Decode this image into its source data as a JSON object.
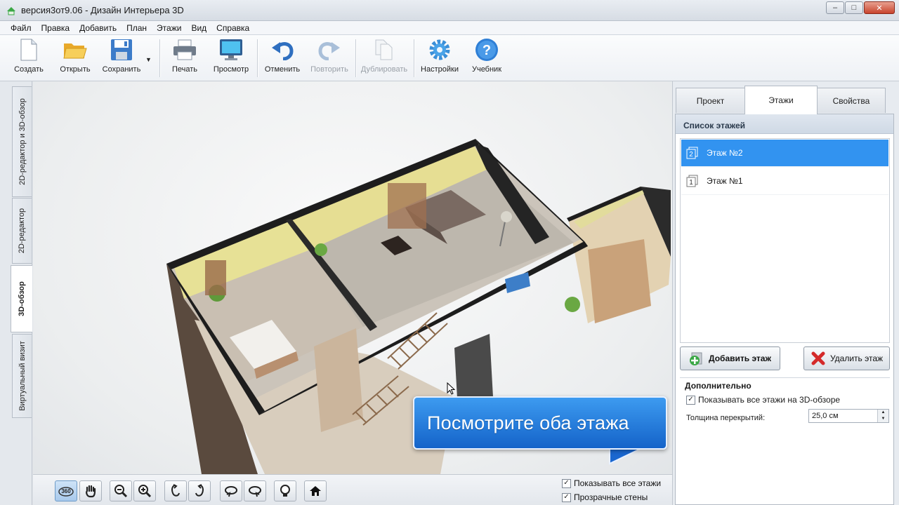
{
  "window": {
    "title": "версия3от9.06 - Дизайн Интерьера 3D"
  },
  "menu": [
    "Файл",
    "Правка",
    "Добавить",
    "План",
    "Этажи",
    "Вид",
    "Справка"
  ],
  "toolbar": {
    "create": "Создать",
    "open": "Открыть",
    "save": "Сохранить",
    "print": "Печать",
    "preview": "Просмотр",
    "undo": "Отменить",
    "redo": "Повторить",
    "duplicate": "Дублировать",
    "settings": "Настройки",
    "tutorial": "Учебник"
  },
  "left_tabs": [
    "2D-редактор и 3D-обзор",
    "2D-редактор",
    "3D-обзор",
    "Виртуальный визит"
  ],
  "callout": {
    "text": "Посмотрите оба этажа"
  },
  "bottom": {
    "show_all_floors": "Показывать все этажи",
    "transparent_walls": "Прозрачные стены",
    "tools": [
      "360-icon",
      "hand-icon",
      "zoom-out-icon",
      "zoom-in-icon",
      "rotate-left-icon",
      "rotate-right-icon",
      "tilt-down-icon",
      "tilt-up-icon",
      "light-icon",
      "home-icon"
    ]
  },
  "right_panel": {
    "tabs": [
      "Проект",
      "Этажи",
      "Свойства"
    ],
    "active_tab": "Этажи",
    "list_title": "Список этажей",
    "floors": [
      {
        "num": "2",
        "label": "Этаж №2",
        "selected": true
      },
      {
        "num": "1",
        "label": "Этаж №1",
        "selected": false
      }
    ],
    "add_floor": "Добавить этаж",
    "delete_floor": "Удалить этаж",
    "extra_title": "Дополнительно",
    "show_all_3d": "Показывать все этажи на 3D-обзоре",
    "slab_label": "Толщина перекрытий:",
    "slab_value": "25,0 см"
  },
  "colors": {
    "selection": "#3293f0",
    "callout": "#1f76dc",
    "disabled_text": "#9aa0a8"
  }
}
